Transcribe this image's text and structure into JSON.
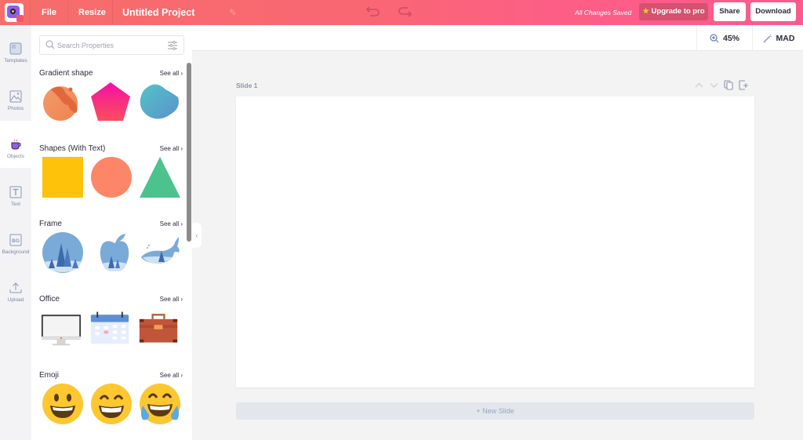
{
  "topbar": {
    "menu": [
      "File",
      "Resize"
    ],
    "project_title": "Untitled Project",
    "status": "All Changes Saved",
    "upgrade_label": "Upgrade to pro",
    "share_label": "Share",
    "download_label": "Download",
    "gradient_colors": [
      "#f66d6a",
      "#fd5a8c"
    ]
  },
  "subbar": {
    "zoom": "45%",
    "magic_label": "MAD"
  },
  "rail": {
    "items": [
      {
        "label": "Templates",
        "icon": "template-icon"
      },
      {
        "label": "Photos",
        "icon": "image-icon"
      },
      {
        "label": "Objects",
        "icon": "coffee-cup-icon",
        "active": true
      },
      {
        "label": "Text",
        "icon": "text-icon"
      },
      {
        "label": "Background",
        "icon": "bg-icon"
      },
      {
        "label": "Upload",
        "icon": "upload-icon"
      }
    ]
  },
  "panel": {
    "search_placeholder": "Search Properties",
    "see_all": "See all",
    "sections": [
      {
        "title": "Gradient shape",
        "items": [
          "orange-blob",
          "pink-pentagon",
          "teal-blob"
        ]
      },
      {
        "title": "Shapes (With Text)",
        "items": [
          "yellow-square",
          "salmon-circle",
          "green-triangle"
        ]
      },
      {
        "title": "Frame",
        "items": [
          "circle-frame",
          "apple-frame",
          "whale-frame"
        ]
      },
      {
        "title": "Office",
        "items": [
          "monitor",
          "calendar",
          "briefcase"
        ]
      },
      {
        "title": "Emoji",
        "items": [
          "smiling-face",
          "grinning-face",
          "tears-of-joy-face"
        ]
      }
    ]
  },
  "editor": {
    "slide_label": "Slide 1",
    "new_slide_label": "+ New Slide"
  }
}
